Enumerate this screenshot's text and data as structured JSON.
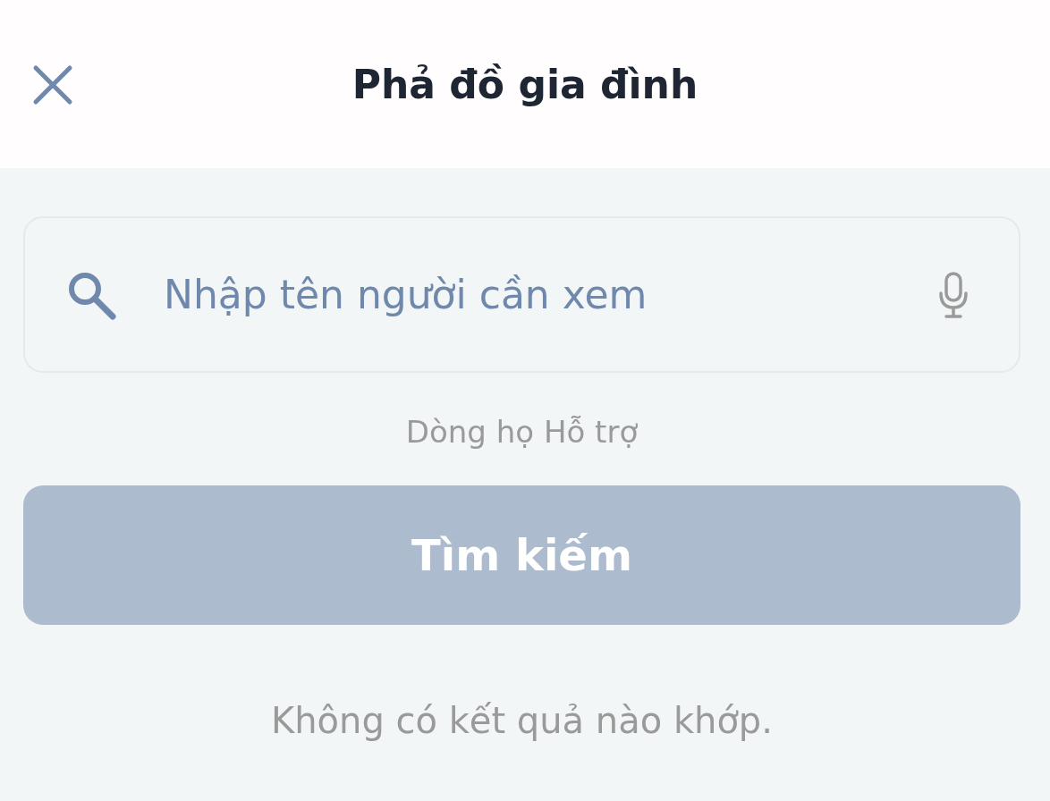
{
  "header": {
    "title": "Phả đồ gia đình"
  },
  "search": {
    "placeholder": "Nhập tên người cần xem"
  },
  "hint": "Dòng họ Hỗ trợ",
  "search_button": {
    "label": "Tìm kiếm",
    "disabled": true
  },
  "empty_message": "Không có kết quả nào khớp."
}
